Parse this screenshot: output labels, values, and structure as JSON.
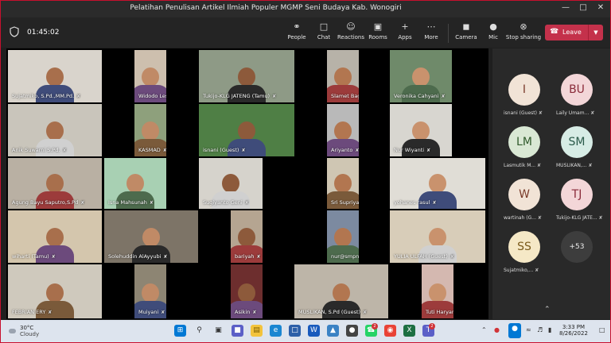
{
  "window": {
    "title": "Pelatihan Penulisan Artikel Ilmiah Populer MGMP Seni Budaya Kab. Wonogiri"
  },
  "meeting": {
    "timer": "01:45:02",
    "toolbar": {
      "people": "People",
      "chat": "Chat",
      "reactions": "Reactions",
      "rooms": "Rooms",
      "apps": "Apps",
      "more": "More",
      "camera": "Camera",
      "mic": "Mic",
      "share": "Stop sharing",
      "leave": "Leave"
    }
  },
  "participants": [
    {
      "name": "Sujatmiko, S.Pd.,MM.Pd."
    },
    {
      "name": "Widodo Lestari"
    },
    {
      "name": "Tukijo-KLG JATENG (Tamu)"
    },
    {
      "name": "Slamet Bagusono"
    },
    {
      "name": "Veronika Cahyani"
    },
    {
      "name": "Anik Suwarni S.Pd."
    },
    {
      "name": "KASMAD"
    },
    {
      "name": "isnani (Guest)"
    },
    {
      "name": "Ariyanto"
    },
    {
      "name": "Nur Wiyanti"
    },
    {
      "name": "Agung Bayu Saputro,S.Pd"
    },
    {
      "name": "Isna Mahsunah"
    },
    {
      "name": "Sugiyanto Geni"
    },
    {
      "name": "Sri Supriyanti"
    },
    {
      "name": "yohanes rasul"
    },
    {
      "name": "wiharti (Tamu)"
    },
    {
      "name": "Solehuddin AlAyyubi"
    },
    {
      "name": "bariyah"
    },
    {
      "name": "nur@smpn1wonogiri.sch.id"
    },
    {
      "name": "YULIA ULFAH (Guest)"
    },
    {
      "name": "FEBRIAN ERY"
    },
    {
      "name": "Muiyani"
    },
    {
      "name": "Asikin"
    },
    {
      "name": "MUSLIKAN, S.Pd (Guest)"
    },
    {
      "name": "Tuti Haryani"
    }
  ],
  "panel": {
    "avatars": [
      {
        "initials": "I",
        "name": "isnani (Guest)"
      },
      {
        "initials": "BU",
        "name": "Laily Umam..."
      },
      {
        "initials": "LM",
        "name": "Lasmutik M..."
      },
      {
        "initials": "SM",
        "name": "MUSLIKAN,..."
      },
      {
        "initials": "W",
        "name": "wartinah (G..."
      },
      {
        "initials": "TJ",
        "name": "Tukijo-KLG JATE..."
      },
      {
        "initials": "SS",
        "name": "Sujatmiko,..."
      }
    ],
    "more_count": "+53"
  },
  "taskbar": {
    "weather_temp": "30°C",
    "weather_desc": "Cloudy",
    "time": "3:33 PM",
    "date": "8/26/2022",
    "badge_whatsapp": "2",
    "badge_teams": "2"
  }
}
